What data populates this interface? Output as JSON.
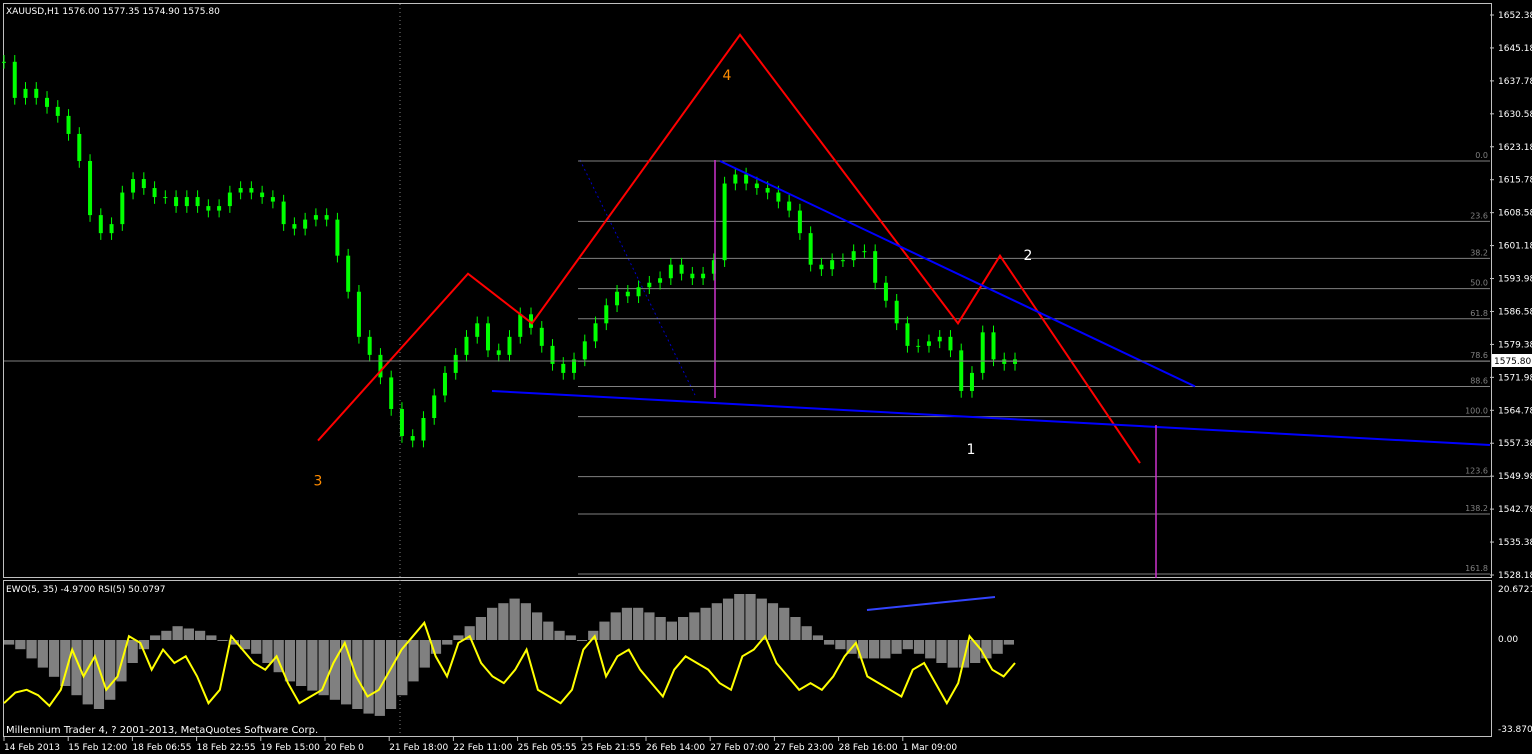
{
  "colors": {
    "background": "#000000",
    "grid": "#c0c0c0",
    "bull_candle": "#00ff00",
    "wave_lines": "#ff0000",
    "trend_lines": "#0000ff",
    "fib_lines": "#808080",
    "rsi_line": "#ffff00",
    "ewo_histogram": "#808080",
    "markers": "#cc33cc",
    "text": "#ffffff",
    "wave_label_orange": "#ff8c00"
  },
  "header": {
    "symbol_line": "XAUUSD,H1  1576.00 1577.35 1574.90 1575.80"
  },
  "indicator": {
    "label": "EWO(5, 35) -4.9700  RSI(5) 50.0797",
    "scale": [
      "20.6721",
      "0.00",
      "-33.8706"
    ]
  },
  "footer": {
    "copyright": "Millennium Trader 4, ? 2001-2013, MetaQuotes Software Corp."
  },
  "chart_data": {
    "type": "line",
    "symbol": "XAUUSD",
    "timeframe": "H1",
    "ohlc": {
      "open": 1576.0,
      "high": 1577.35,
      "low": 1574.9,
      "close": 1575.8
    },
    "x_tick_labels": [
      "14 Feb 2013",
      "15 Feb 12:00",
      "18 Feb 06:55",
      "18 Feb 22:55",
      "19 Feb 15:00",
      "20 Feb 0",
      "21 Feb 18:00",
      "22 Feb 11:00",
      "25 Feb 05:55",
      "25 Feb 21:55",
      "26 Feb 14:00",
      "27 Feb 07:00",
      "27 Feb 23:00",
      "28 Feb 16:00",
      "1 Mar 09:00"
    ],
    "y_tick_labels": [
      "1652.38",
      "1645.18",
      "1637.78",
      "1630.58",
      "1623.18",
      "1615.78",
      "1608.58",
      "1601.18",
      "1593.98",
      "1586.58",
      "1579.38",
      "1571.98",
      "1564.78",
      "1557.38",
      "1549.98",
      "1542.78",
      "1535.38",
      "1528.18"
    ],
    "current_price_label": "1575.80",
    "ylim": [
      1526,
      1656
    ],
    "price_series": [
      1642,
      1634,
      1636,
      1634,
      1632,
      1630,
      1626,
      1620,
      1608,
      1604,
      1606,
      1613,
      1616,
      1614,
      1612,
      1612,
      1610,
      1612,
      1610,
      1609,
      1610,
      1613,
      1614,
      1613,
      1612,
      1611,
      1606,
      1605,
      1607,
      1608,
      1607,
      1599,
      1591,
      1581,
      1577,
      1572,
      1565,
      1559,
      1558,
      1563,
      1568,
      1573,
      1577,
      1581,
      1584,
      1578,
      1577,
      1581,
      1586,
      1583,
      1579,
      1575,
      1573,
      1576,
      1580,
      1584,
      1588,
      1591,
      1590,
      1592,
      1593,
      1594,
      1597,
      1595,
      1594,
      1595,
      1598,
      1615,
      1617,
      1615,
      1614,
      1613,
      1611,
      1609,
      1604,
      1597,
      1596,
      1598,
      1598,
      1600,
      1600,
      1593,
      1589,
      1584,
      1579,
      1579,
      1580,
      1581,
      1578,
      1569,
      1573,
      1582,
      1576,
      1575,
      1576
    ],
    "fibonacci": {
      "levels": [
        "0.0",
        "23.6",
        "38.2",
        "50.0",
        "61.8",
        "78.6",
        "88.6",
        "100.0",
        "123.6",
        "138.2",
        "161.8"
      ],
      "values": [
        1620.0,
        1606.6,
        1598.4,
        1591.7,
        1585.0,
        1575.6,
        1570.0,
        1563.3,
        1550.0,
        1541.7,
        1528.4
      ]
    },
    "wave_path": [
      {
        "date": "20 Feb 00:00",
        "price": 1558
      },
      {
        "date": "21 Feb 04:00",
        "price": 1595
      },
      {
        "date": "22 Feb 00:00",
        "price": 1584
      },
      {
        "date": "26 Feb 06:00",
        "price": 1648
      },
      {
        "date": "28 Feb 20:00",
        "price": 1584
      },
      {
        "date": "1 Mar 04:00",
        "price": 1599
      },
      {
        "date": "1 Mar 22:00",
        "price": 1553
      }
    ],
    "wave_labels": [
      {
        "text": "3",
        "date": "20 Feb 00:00",
        "price": 1548
      },
      {
        "text": "4",
        "date": "26 Feb 03:00",
        "price": 1638
      },
      {
        "text": "1",
        "date": "1 Mar 00:00",
        "price": 1555
      },
      {
        "text": "2",
        "date": "1 Mar 09:00",
        "price": 1598
      }
    ],
    "trend_lines": [
      {
        "from": {
          "date": "26 Feb 14:00",
          "price": 1620
        },
        "to": {
          "date": "1 Mar 18:00",
          "price": 1570
        }
      },
      {
        "from": {
          "date": "21 Feb 18:00",
          "price": 1569
        },
        "to": {
          "date": "end",
          "price": 1557
        }
      }
    ],
    "ewo_histogram": [
      -2,
      -4,
      -8,
      -12,
      -16,
      -20,
      -24,
      -28,
      -30,
      -26,
      -18,
      -10,
      -4,
      2,
      4,
      6,
      5,
      4,
      2,
      0,
      -2,
      -4,
      -6,
      -10,
      -14,
      -18,
      -20,
      -22,
      -24,
      -26,
      -28,
      -30,
      -32,
      -33,
      -30,
      -24,
      -18,
      -12,
      -6,
      -2,
      2,
      6,
      10,
      14,
      16,
      18,
      16,
      12,
      8,
      4,
      2,
      0,
      4,
      8,
      12,
      14,
      14,
      12,
      10,
      8,
      10,
      12,
      14,
      16,
      18,
      20,
      20,
      18,
      16,
      14,
      10,
      6,
      2,
      -2,
      -4,
      -6,
      -8,
      -8,
      -8,
      -6,
      -4,
      -6,
      -8,
      -10,
      -12,
      -12,
      -10,
      -8,
      -6,
      -2
    ],
    "rsi_series": [
      20,
      28,
      30,
      26,
      18,
      30,
      60,
      40,
      55,
      30,
      40,
      70,
      65,
      45,
      60,
      50,
      55,
      40,
      20,
      30,
      70,
      60,
      50,
      45,
      55,
      35,
      20,
      25,
      30,
      50,
      65,
      40,
      25,
      30,
      45,
      60,
      70,
      80,
      55,
      40,
      65,
      70,
      50,
      40,
      35,
      45,
      60,
      30,
      25,
      20,
      30,
      60,
      70,
      40,
      55,
      60,
      45,
      35,
      25,
      45,
      55,
      50,
      45,
      35,
      30,
      55,
      60,
      70,
      50,
      40,
      30,
      35,
      30,
      40,
      55,
      65,
      40,
      35,
      30,
      25,
      45,
      50,
      35,
      20,
      35,
      70,
      60,
      45,
      40,
      50
    ]
  }
}
